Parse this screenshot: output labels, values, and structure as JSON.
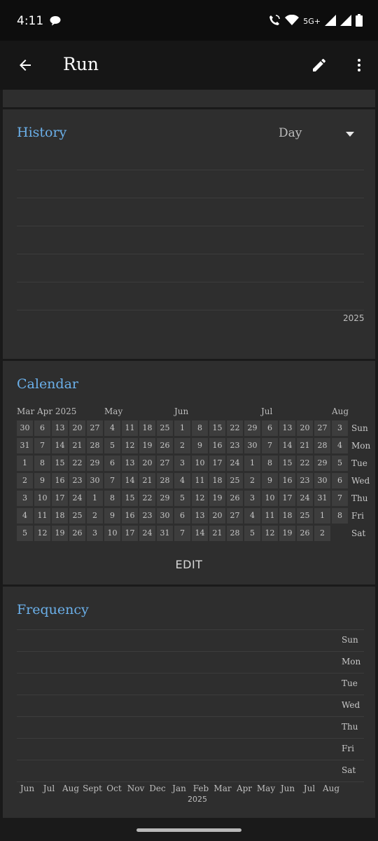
{
  "status_bar": {
    "time": "4:11",
    "network": "5G+"
  },
  "app_bar": {
    "title": "Run"
  },
  "history": {
    "title": "History",
    "period": "Day",
    "year_label": "2025"
  },
  "calendar": {
    "title": "Calendar",
    "months": [
      "Mar Apr 2025",
      "May",
      "Jun",
      "Jul",
      "Aug"
    ],
    "weekdays": [
      "Sun",
      "Mon",
      "Tue",
      "Wed",
      "Thu",
      "Fri",
      "Sat"
    ],
    "columns": [
      [
        "30",
        "31",
        "1",
        "2",
        "3",
        "4",
        "5"
      ],
      [
        "6",
        "7",
        "8",
        "9",
        "10",
        "11",
        "12"
      ],
      [
        "13",
        "14",
        "15",
        "16",
        "17",
        "18",
        "19"
      ],
      [
        "20",
        "21",
        "22",
        "23",
        "24",
        "25",
        "26"
      ],
      [
        "27",
        "28",
        "29",
        "30",
        "1",
        "2",
        "3"
      ],
      [
        "4",
        "5",
        "6",
        "7",
        "8",
        "9",
        "10"
      ],
      [
        "11",
        "12",
        "13",
        "14",
        "15",
        "16",
        "17"
      ],
      [
        "18",
        "19",
        "20",
        "21",
        "22",
        "23",
        "24"
      ],
      [
        "25",
        "26",
        "27",
        "28",
        "29",
        "30",
        "31"
      ],
      [
        "1",
        "2",
        "3",
        "4",
        "5",
        "6",
        "7"
      ],
      [
        "8",
        "9",
        "10",
        "11",
        "12",
        "13",
        "14"
      ],
      [
        "15",
        "16",
        "17",
        "18",
        "19",
        "20",
        "21"
      ],
      [
        "22",
        "23",
        "24",
        "25",
        "26",
        "27",
        "28"
      ],
      [
        "29",
        "30",
        "1",
        "2",
        "3",
        "4",
        "5"
      ],
      [
        "6",
        "7",
        "8",
        "9",
        "10",
        "11",
        "12"
      ],
      [
        "13",
        "14",
        "15",
        "16",
        "17",
        "18",
        "19"
      ],
      [
        "20",
        "21",
        "22",
        "23",
        "24",
        "25",
        "26"
      ],
      [
        "27",
        "28",
        "29",
        "30",
        "31",
        "1",
        "2"
      ],
      [
        "3",
        "4",
        "5",
        "6",
        "7",
        "8",
        ""
      ]
    ],
    "edit_label": "EDIT"
  },
  "frequency": {
    "title": "Frequency",
    "days": [
      "Sun",
      "Mon",
      "Tue",
      "Wed",
      "Thu",
      "Fri",
      "Sat"
    ],
    "months": [
      "Jun",
      "Jul",
      "Aug",
      "Sept",
      "Oct",
      "Nov",
      "Dec",
      "Jan",
      "Feb",
      "Mar",
      "Apr",
      "May",
      "Jun",
      "Jul",
      "Aug"
    ],
    "year_label": "2025"
  },
  "colors": {
    "accent": "#6bb0ea",
    "card": "#2e2e2e",
    "background": "#1a1a1a",
    "cell": "#3d3d3d"
  }
}
